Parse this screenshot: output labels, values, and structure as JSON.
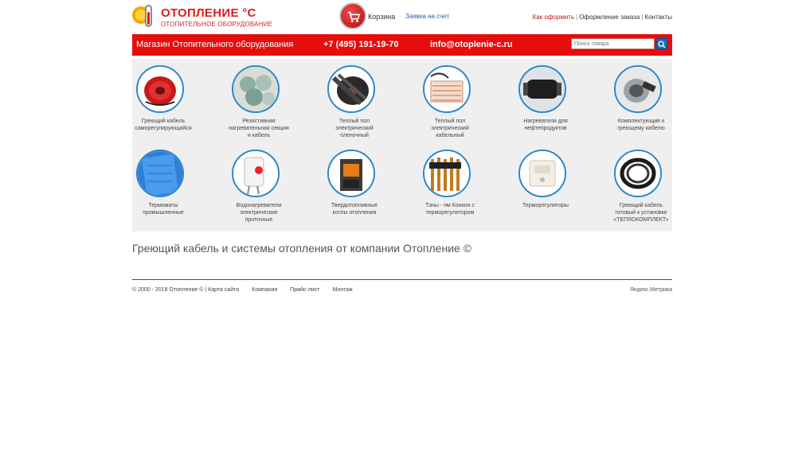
{
  "header": {
    "logo_title": "ОТОПЛЕНИЕ °С",
    "logo_subtitle": "ОТОПИТЕЛЬНОЕ ОБОРУДОВАНИЕ",
    "cart_label": "Корзина",
    "invoice_label": "Заявка на счет",
    "top_links": [
      "Как оформить",
      "Оформление заказа",
      "Контакты"
    ]
  },
  "redbar": {
    "shop_title": "Магазин Отопительного оборудования",
    "phone": "+7 (495) 191-19-70",
    "email": "info@otoplenie-c.ru",
    "search_placeholder": "Поиск товара"
  },
  "categories": [
    {
      "label": "Греющий кабель саморегулирующийся"
    },
    {
      "label": "Резистивная нагревательная секция и кабель"
    },
    {
      "label": "Теплый пол электрический пленочный"
    },
    {
      "label": "Теплый пол электрический кабельный"
    },
    {
      "label": "Нагреватели для нефтепродуктов"
    },
    {
      "label": "Комплектующие к греющему кабелю"
    },
    {
      "label": "Термоматы промышленные"
    },
    {
      "label": "Водонагреватели электрические проточные"
    },
    {
      "label": "Твердотопливные котлы отопления"
    },
    {
      "label": "Тэны - пм Конкон с терморегулятором"
    },
    {
      "label": "Терморегуляторы"
    },
    {
      "label": "Греющий кабель готовый к установке «ТЕПЛОКОМПЛЕКТ»"
    }
  ],
  "headline": "Греющий кабель и системы отопления от компании Отопление ©",
  "footer": {
    "copyright": "© 2000 - 2018 Отопление © | Карта сайта",
    "links": [
      "Компания",
      "Прайс-лист",
      "Монтаж"
    ],
    "metrika": "Яндекс.Метрика"
  },
  "colors": {
    "accent": "#e60d0d",
    "ring": "#2a87c9",
    "grid_bg": "#efefef"
  }
}
